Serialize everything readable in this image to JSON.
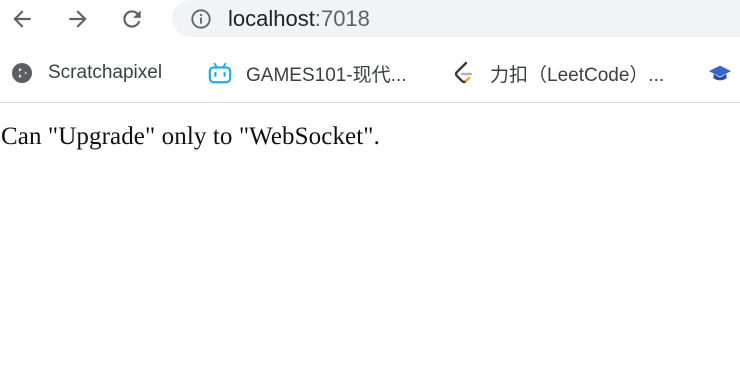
{
  "toolbar": {
    "back_icon": "arrow-left-icon",
    "forward_icon": "arrow-right-icon",
    "reload_icon": "reload-icon"
  },
  "address_bar": {
    "icon": "info-icon",
    "host": "localhost",
    "port": ":7018"
  },
  "bookmarks": [
    {
      "label": "Scratchapixel",
      "icon": "scratchapixel-favicon"
    },
    {
      "label": "GAMES101-现代...",
      "icon": "bilibili-favicon"
    },
    {
      "label": "力扣（LeetCode）...",
      "icon": "leetcode-favicon"
    },
    {
      "label": "",
      "icon": "graduation-cap-favicon"
    }
  ],
  "page": {
    "message": "Can \"Upgrade\" only to \"WebSocket\"."
  },
  "colors": {
    "omnibox_bg": "#f1f3f4",
    "icon_gray": "#5f6368",
    "bilibili_blue": "#23ade5",
    "leetcode_orange": "#ffa116"
  }
}
